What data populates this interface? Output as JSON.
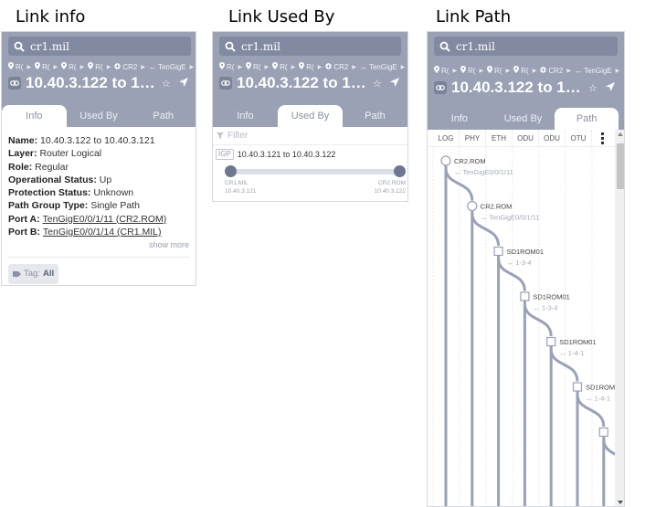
{
  "captions": {
    "info": "Link info",
    "used_by": "Link Used By",
    "path": "Link Path"
  },
  "header": {
    "search_value": "cr1.mil",
    "breadcrumbs": [
      {
        "icon": "location-pin-icon",
        "label": "R("
      },
      {
        "icon": "location-pin-icon",
        "label": "R("
      },
      {
        "icon": "location-pin-icon",
        "label": "R("
      },
      {
        "icon": "location-pin-icon",
        "label": "R("
      },
      {
        "icon": "router-icon",
        "label": "CR2"
      },
      {
        "icon": "link-arrows-icon",
        "label": "TenGigE"
      }
    ],
    "title": "10.40.3.122 to 1…",
    "tabs": [
      "Info",
      "Used By",
      "Path"
    ]
  },
  "info": {
    "fields": [
      {
        "label": "Name:",
        "value": "10.40.3.122 to 10.40.3.121"
      },
      {
        "label": "Layer:",
        "value": "Router Logical"
      },
      {
        "label": "Role:",
        "value": "Regular"
      },
      {
        "label": "Operational Status:",
        "value": "Up"
      },
      {
        "label": "Protection Status:",
        "value": "Unknown"
      },
      {
        "label": "Path Group Type:",
        "value": "Single Path"
      },
      {
        "label": "Port A:",
        "value": "TenGigE0/0/1/11 (CR2.ROM)",
        "link": true
      },
      {
        "label": "Port B:",
        "value": "TenGigE0/0/1/14 (CR1.MIL)",
        "link": true
      }
    ],
    "show_more": "show more",
    "tag_label": "Tag:",
    "tag_value": "All"
  },
  "used_by": {
    "filter_placeholder": "Filter",
    "items": [
      {
        "badge": "IGP",
        "title": "10.40.3.121 to 10.40.3.122",
        "left_node": "CR1.MIL",
        "left_ip": "10.40.3.121",
        "right_node": "CR2.ROM",
        "right_ip": "10.40.3.122"
      }
    ]
  },
  "path": {
    "columns": [
      "LOG",
      "PHY",
      "ETH",
      "ODU",
      "ODU",
      "OTU"
    ],
    "more_columns_icon": "more-vertical-icon",
    "nodes": [
      {
        "shape": "circle",
        "name": "CR2.ROM",
        "port": "TenGigE0/0/1/11"
      },
      {
        "shape": "circle",
        "name": "CR2.ROM",
        "port": "TenGigE0/0/1/11"
      },
      {
        "shape": "square",
        "name": "SD1ROM01",
        "port": "1-3-4"
      },
      {
        "shape": "square",
        "name": "SD1ROM01",
        "port": "1-3-4"
      },
      {
        "shape": "square",
        "name": "SD1ROM01",
        "port": "1-4-1"
      },
      {
        "shape": "square",
        "name": "SD1ROM",
        "port": "1-4-1"
      },
      {
        "shape": "square",
        "name": "",
        "port": ""
      }
    ]
  }
}
